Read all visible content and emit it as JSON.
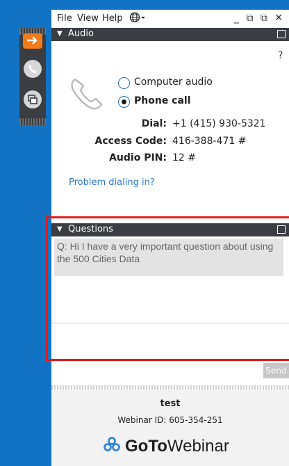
{
  "menu": {
    "file": "File",
    "view": "View",
    "help": "Help"
  },
  "window_controls": "_ ⧉ ⧉ ✕",
  "audio": {
    "header": "Audio",
    "help_icon_text": "?",
    "computer_audio_label": "Computer audio",
    "phone_call_label": "Phone call",
    "selected": "phone_call",
    "dial_label": "Dial:",
    "dial_value": "+1 (415) 930-5321",
    "access_code_label": "Access Code:",
    "access_code_value": "416-388-471 #",
    "audio_pin_label": "Audio PIN:",
    "audio_pin_value": "12 #",
    "problem_link": "Problem dialing in?"
  },
  "questions": {
    "header": "Questions",
    "log_text": "Q: Hi I have a very important question about using the 500 Cities Data",
    "input_value": "",
    "send_label": "Send"
  },
  "footer": {
    "webinar_title": "test",
    "webinar_id": "Webinar ID: 605-354-251",
    "brand_go": "GoTo",
    "brand_rest": "Webinar"
  },
  "colors": {
    "background_blue": "#1273c4",
    "panel_header": "#3a3d42",
    "accent_orange": "#f27a1a",
    "highlight_red": "#e21a1a",
    "link_blue": "#2b78c9"
  },
  "icons": {
    "show_hide": "arrow-right-icon",
    "phone": "phone-icon",
    "screen": "screen-share-icon",
    "globe": "globe-icon",
    "brand": "gotowebinar-logo-icon"
  }
}
